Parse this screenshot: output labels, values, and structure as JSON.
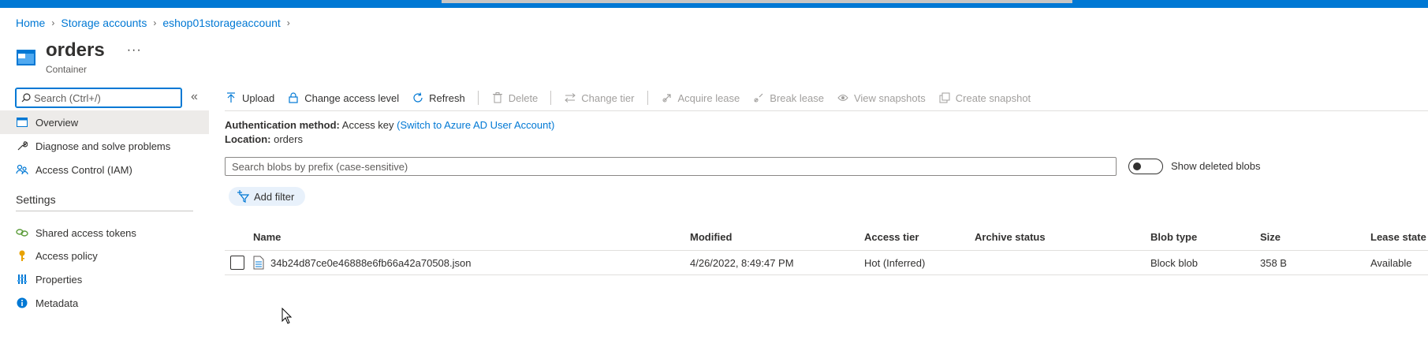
{
  "breadcrumb": [
    "Home",
    "Storage accounts",
    "eshop01storageaccount"
  ],
  "header": {
    "title": "orders",
    "subtitle": "Container",
    "more": "···"
  },
  "sidebar": {
    "search_placeholder": "Search (Ctrl+/)",
    "collapse": "«",
    "items": [
      {
        "label": "Overview",
        "icon": "container-icon"
      },
      {
        "label": "Diagnose and solve problems",
        "icon": "wrench-icon"
      },
      {
        "label": "Access Control (IAM)",
        "icon": "people-icon"
      }
    ],
    "section": "Settings",
    "settings_items": [
      {
        "label": "Shared access tokens",
        "icon": "link-icon"
      },
      {
        "label": "Access policy",
        "icon": "key-icon"
      },
      {
        "label": "Properties",
        "icon": "properties-icon"
      },
      {
        "label": "Metadata",
        "icon": "info-icon"
      }
    ]
  },
  "toolbar": {
    "upload": "Upload",
    "change_access": "Change access level",
    "refresh": "Refresh",
    "delete": "Delete",
    "change_tier": "Change tier",
    "acquire_lease": "Acquire lease",
    "break_lease": "Break lease",
    "view_snapshots": "View snapshots",
    "create_snapshot": "Create snapshot"
  },
  "info": {
    "auth_label": "Authentication method:",
    "auth_value": "Access key",
    "auth_link": "(Switch to Azure AD User Account)",
    "location_label": "Location:",
    "location_value": "orders"
  },
  "blob_search_placeholder": "Search blobs by prefix (case-sensitive)",
  "show_deleted": "Show deleted blobs",
  "add_filter": "Add filter",
  "table": {
    "headers": [
      "Name",
      "Modified",
      "Access tier",
      "Archive status",
      "Blob type",
      "Size",
      "Lease state"
    ],
    "rows": [
      {
        "name": "34b24d87ce0e46888e6fb66a42a70508.json",
        "modified": "4/26/2022, 8:49:47 PM",
        "access_tier": "Hot (Inferred)",
        "archive_status": "",
        "blob_type": "Block blob",
        "size": "358 B",
        "lease_state": "Available"
      }
    ]
  },
  "colors": {
    "accent": "#0078d4",
    "active_nav": "#edebe9",
    "disabled": "#a19f9d"
  }
}
